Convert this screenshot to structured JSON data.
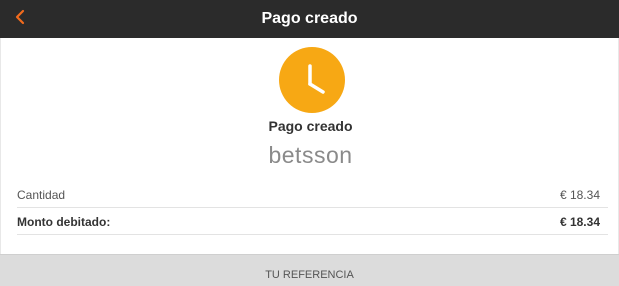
{
  "header": {
    "title": "Pago creado",
    "back_icon": "chevron-left-icon",
    "back_color": "#f26b1d",
    "background": "#2b2b2b"
  },
  "status": {
    "icon": "clock-icon",
    "icon_color": "#f7a814",
    "title": "Pago creado"
  },
  "merchant": {
    "name": "betsson"
  },
  "details": {
    "amount_label": "Cantidad",
    "amount_value": "€ 18.34",
    "debited_label": "Monto debitado:",
    "debited_value": "€ 18.34"
  },
  "reference": {
    "label": "TU REFERENCIA"
  }
}
